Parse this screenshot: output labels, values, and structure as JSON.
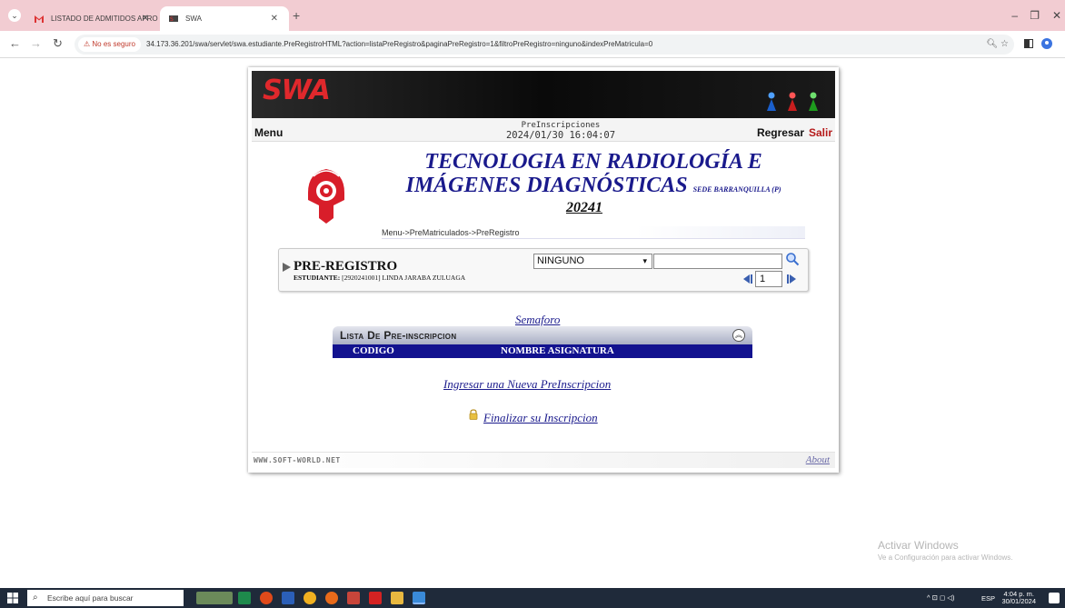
{
  "browser": {
    "tabs": [
      {
        "label": "LISTADO DE ADMITIDOS APRO"
      },
      {
        "label": "SWA"
      }
    ],
    "not_secure_label": "No es seguro",
    "url": "34.173.36.201/swa/servlet/swa.estudiante.PreRegistroHTML?action=listaPreRegistro&paginaPreRegistro=1&filtroPreRegistro=ninguno&indexPreMatricula=0"
  },
  "app": {
    "banner_logo": "SWA",
    "menu_label": "Menu",
    "page_name": "PreInscripciones",
    "datetime": "2024/01/30 16:04:07",
    "regresar": "Regresar",
    "salir": "Salir",
    "program_title": "TECNOLOGIA EN RADIOLOGÍA E IMÁGENES DIAGNÓSTICAS",
    "sede": "SEDE BARRANQUILLA (P)",
    "period": "20241",
    "breadcrumb": "Menu->PreMatriculados->PreRegistro"
  },
  "preregistro": {
    "heading": "PRE-REGISTRO",
    "student_label": "ESTUDIANTE:",
    "student_value": "[2920241001] LINDA JARABA ZULUAGA",
    "filter_selected": "NINGUNO",
    "search_value": "",
    "page_value": "1"
  },
  "links": {
    "semaforo": "Semaforo",
    "ingresar": "Ingresar una Nueva PreInscripcion",
    "finalizar": "Finalizar su Inscripcion",
    "about": "About"
  },
  "lista": {
    "title": "Lista De Pre-inscripcion",
    "columns": [
      "CODIGO",
      "NOMBRE ASIGNATURA"
    ]
  },
  "footer": {
    "brand": "WWW.SOFT-WORLD.NET"
  },
  "os": {
    "watermark_title": "Activar Windows",
    "watermark_sub": "Ve a Configuración para activar Windows.",
    "search_placeholder": "Escribe aquí para buscar",
    "lang": "ESP",
    "time": "4:04 p. m.",
    "date": "30/01/2024"
  },
  "colors": {
    "heading_blue": "#1a1a8c",
    "table_header_blue": "#12128f",
    "salir_red": "#b51a1a",
    "tabbar_pink": "#f2ccd2"
  }
}
